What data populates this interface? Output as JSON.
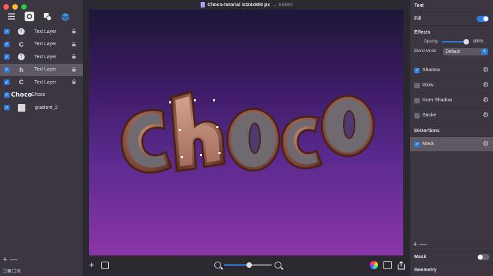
{
  "window": {
    "title": "Choco-tutorial 1024x800 px",
    "status": "— Edited"
  },
  "sidebar": {
    "layers": [
      {
        "name": "Text Layer",
        "thumb": "",
        "thumb_kind": "round",
        "selected": false
      },
      {
        "name": "Text Layer",
        "thumb": "C",
        "thumb_kind": "letter",
        "selected": false
      },
      {
        "name": "Text Layer",
        "thumb": "",
        "thumb_kind": "round",
        "selected": false
      },
      {
        "name": "Text Layer",
        "thumb": "h",
        "thumb_kind": "letter",
        "selected": true
      },
      {
        "name": "Text Layer",
        "thumb": "C",
        "thumb_kind": "letter",
        "selected": false
      },
      {
        "name": "Choco",
        "thumb": "Choco",
        "thumb_kind": "choco",
        "selected": false
      },
      {
        "name": "gradient_2",
        "thumb": "",
        "thumb_kind": "gradient",
        "selected": false
      }
    ],
    "add_label": "+",
    "remove_label": "—"
  },
  "canvas": {
    "artwork_text": "Choco",
    "zoom_fraction": 0.5
  },
  "inspector": {
    "header": "Text",
    "fill_label": "Fill",
    "fill_on": true,
    "effects_title": "Effects",
    "opacity_label": "Opacity",
    "opacity_value": "100%",
    "blend_label": "Blend Mode",
    "blend_value": "Default",
    "effects": [
      {
        "label": "Shadow",
        "checked": true
      },
      {
        "label": "Glow",
        "checked": false
      },
      {
        "label": "Inner Shadow",
        "checked": false
      },
      {
        "label": "Stroke",
        "checked": false
      }
    ],
    "distortions_title": "Distortions",
    "distortions": [
      {
        "label": "Mask",
        "checked": true
      }
    ],
    "mask_label": "Mask",
    "mask_on": false,
    "geometry_label": "Geometry"
  },
  "colors": {
    "accent": "#2f7de1",
    "canvas_top": "#1d1738",
    "canvas_bottom": "#8a36a8",
    "chocolate": "#8b5a4a"
  }
}
